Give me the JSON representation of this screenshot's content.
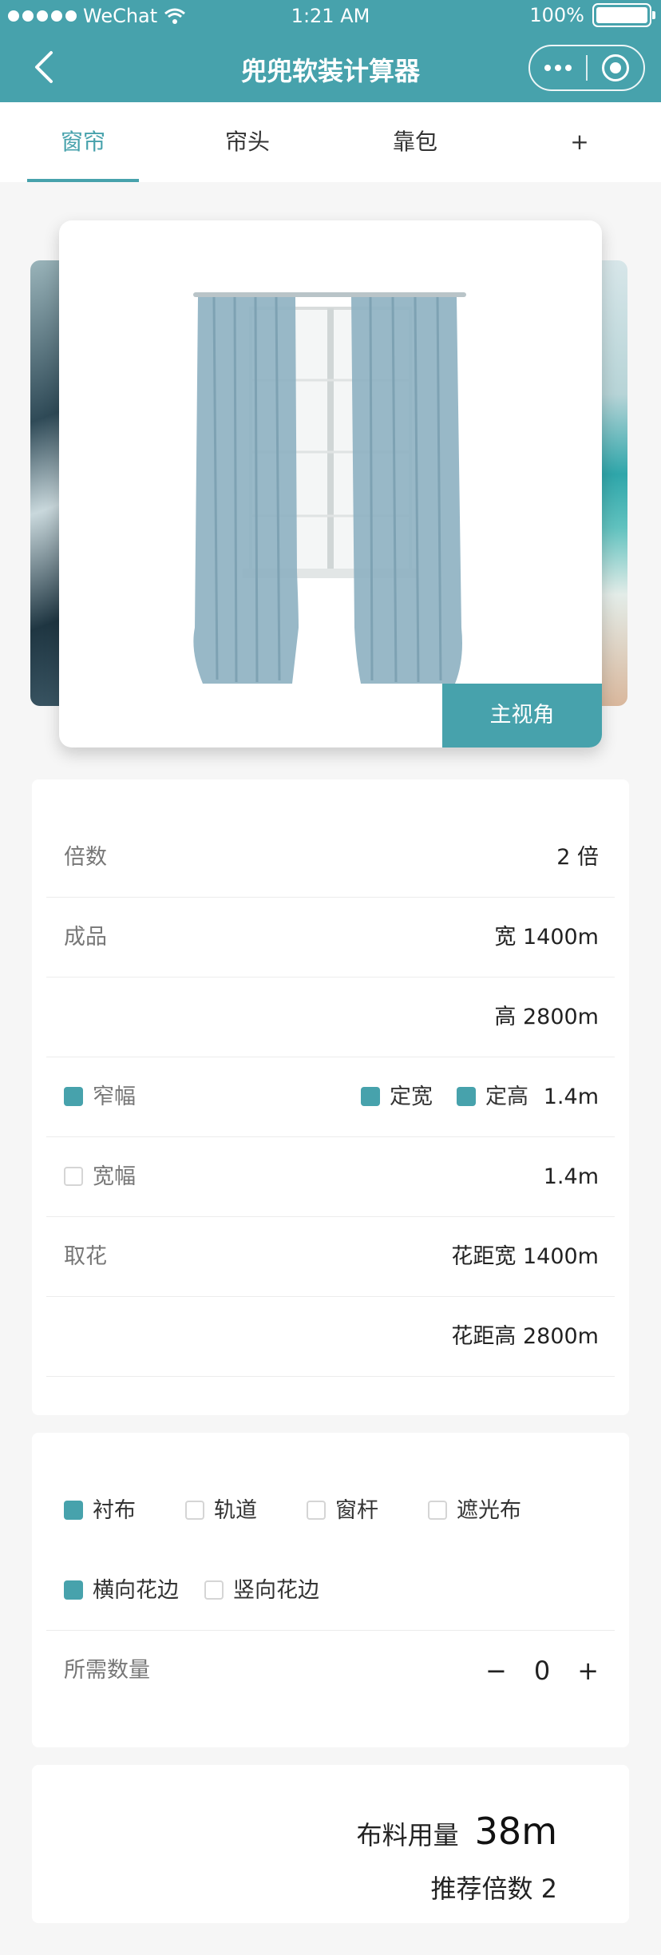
{
  "status_bar": {
    "carrier": "WeChat",
    "time": "1:21 AM",
    "battery": "100%"
  },
  "nav": {
    "title": "兜兜软装计算器"
  },
  "tabs": [
    {
      "label": "窗帘",
      "active": true
    },
    {
      "label": "帘头"
    },
    {
      "label": "靠包"
    },
    {
      "label": "+"
    }
  ],
  "carousel": {
    "button_label": "主视角"
  },
  "params": {
    "multiple_label": "倍数",
    "multiple_value": "2 倍",
    "finished_label": "成品",
    "width_value": "宽 1400m",
    "height_value": "高 2800m",
    "narrow_label": "窄幅",
    "fixed_width_label": "定宽",
    "fixed_height_label": "定高",
    "narrow_value": "1.4m",
    "wide_label": "宽幅",
    "wide_value": "1.4m",
    "pattern_label": "取花",
    "pattern_width_value": "花距宽 1400m",
    "pattern_height_value": "花距高 2800m"
  },
  "options": {
    "lining": "衬布",
    "track": "轨道",
    "rod": "窗杆",
    "blackout": "遮光布",
    "horizontal_border": "横向花边",
    "vertical_border": "竖向花边",
    "quantity_label": "所需数量",
    "quantity_minus": "−",
    "quantity_value": "0",
    "quantity_plus": "+"
  },
  "result": {
    "fabric_label": "布料用量",
    "fabric_value": "38m",
    "recommend_text": "推荐倍数 2"
  },
  "colors": {
    "accent": "#47a2ac"
  }
}
